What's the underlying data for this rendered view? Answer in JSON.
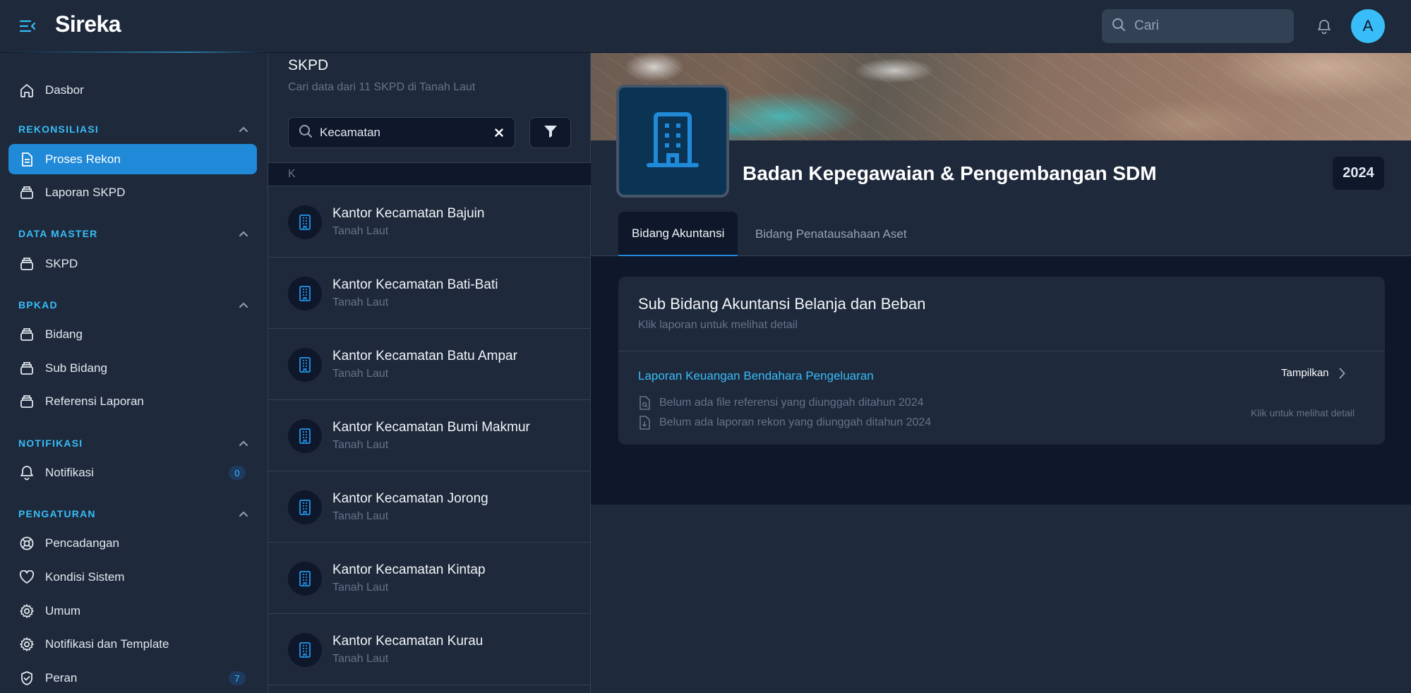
{
  "app": {
    "brand": "Sireka"
  },
  "topbar": {
    "search_placeholder": "Cari",
    "avatar_initial": "A"
  },
  "sidebar": {
    "dashboard": "Dasbor",
    "groups": {
      "rekonsiliasi": "REKONSILIASI",
      "data_master": "DATA MASTER",
      "bpkad": "BPKAD",
      "notifikasi": "NOTIFIKASI",
      "pengaturan": "PENGATURAN"
    },
    "items": {
      "proses_rekon": "Proses Rekon",
      "laporan_skpd": "Laporan SKPD",
      "skpd": "SKPD",
      "bidang": "Bidang",
      "sub_bidang": "Sub Bidang",
      "referensi_laporan": "Referensi Laporan",
      "notifikasi": "Notifikasi",
      "notifikasi_count": "0",
      "pencadangan": "Pencadangan",
      "kondisi_sistem": "Kondisi Sistem",
      "umum": "Umum",
      "notifikasi_template": "Notifikasi dan Template",
      "peran": "Peran",
      "peran_count": "7"
    }
  },
  "list": {
    "title": "SKPD",
    "subtitle": "Cari data dari 11 SKPD di Tanah Laut",
    "filter_value": "Kecamatan",
    "letter": "K",
    "items": [
      {
        "name": "Kantor Kecamatan Bajuin",
        "region": "Tanah Laut"
      },
      {
        "name": "Kantor Kecamatan Bati-Bati",
        "region": "Tanah Laut"
      },
      {
        "name": "Kantor Kecamatan Batu Ampar",
        "region": "Tanah Laut"
      },
      {
        "name": "Kantor Kecamatan Bumi Makmur",
        "region": "Tanah Laut"
      },
      {
        "name": "Kantor Kecamatan Jorong",
        "region": "Tanah Laut"
      },
      {
        "name": "Kantor Kecamatan Kintap",
        "region": "Tanah Laut"
      },
      {
        "name": "Kantor Kecamatan Kurau",
        "region": "Tanah Laut"
      }
    ]
  },
  "detail": {
    "org_title": "Badan Kepegawaian & Pengembangan SDM",
    "year": "2024",
    "tabs": [
      "Bidang Akuntansi",
      "Bidang Penatausahaan Aset"
    ],
    "card": {
      "title": "Sub Bidang Akuntansi Belanja dan Beban",
      "subtitle": "Klik laporan untuk melihat detail",
      "report_name": "Laporan Keuangan Bendahara Pengeluaran",
      "show_label": "Tampilkan",
      "note_reference": "Belum ada file referensi yang diunggah ditahun 2024",
      "note_rekon": "Belum ada laporan rekon yang diunggah ditahun 2024",
      "hint": "Klik untuk melihat detail"
    }
  },
  "colors": {
    "accent": "#2089d8",
    "link": "#38bdf8",
    "bg": "#1e293b",
    "bg_dark": "#0f172a"
  }
}
